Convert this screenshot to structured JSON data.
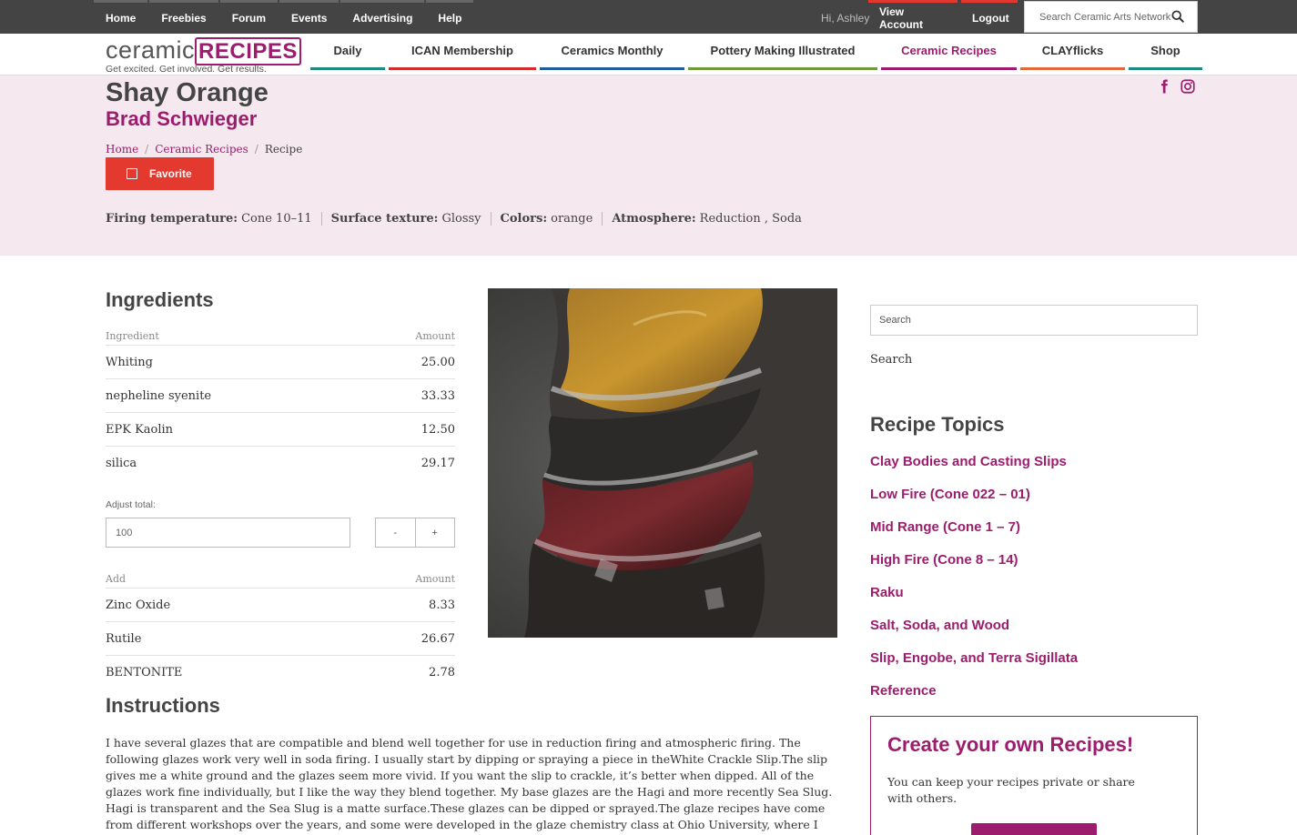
{
  "topbar": {
    "links": [
      "Home",
      "Freebies",
      "Forum",
      "Events",
      "Advertising",
      "Help"
    ],
    "greeting": "Hi, Ashley",
    "view_account": "View Account",
    "logout": "Logout",
    "search_placeholder": "Search Ceramic Arts Network"
  },
  "logo": {
    "ceramic": "ceramic",
    "recipes": "RECIPES",
    "tagline": "Get excited. Get involved. Get results."
  },
  "nav": {
    "items": [
      {
        "label": "Daily",
        "color": "#1f8a7e"
      },
      {
        "label": "ICAN Membership",
        "color": "#d22d2d"
      },
      {
        "label": "Ceramics Monthly",
        "color": "#1f5fa0"
      },
      {
        "label": "Pottery Making Illustrated",
        "color": "#6e9a3a"
      },
      {
        "label": "Ceramic Recipes",
        "color": "#9c1c6e"
      },
      {
        "label": "CLAYflicks",
        "color": "#e06a3a"
      },
      {
        "label": "Shop",
        "color": "#1f8a7e"
      }
    ],
    "active": "Ceramic Recipes"
  },
  "recipe": {
    "title": "Shay Orange",
    "author": "Brad Schwieger",
    "breadcrumb": [
      "Home",
      "Ceramic Recipes",
      "Recipe"
    ],
    "favorite_label": "Favorite",
    "properties": [
      {
        "label": "Firing temperature:",
        "value": "Cone 10–11"
      },
      {
        "label": "Surface texture:",
        "value": "Glossy"
      },
      {
        "label": "Colors:",
        "value": "orange"
      },
      {
        "label": "Atmosphere:",
        "value": "Reduction ,  Soda"
      }
    ]
  },
  "ingredients": {
    "title": "Ingredients",
    "headers": [
      "Ingredient",
      "Amount"
    ],
    "rows": [
      [
        "Whiting",
        "25.00"
      ],
      [
        "nepheline syenite",
        "33.33"
      ],
      [
        "EPK Kaolin",
        "12.50"
      ],
      [
        "silica",
        "29.17"
      ]
    ],
    "adjust_label": "Adjust total:",
    "adjust_value": "100",
    "minus": "-",
    "plus": "+",
    "add_headers": [
      "Add",
      "Amount"
    ],
    "add_rows": [
      [
        "Zinc Oxide",
        "8.33"
      ],
      [
        "Rutile",
        "26.67"
      ],
      [
        "BENTONITE",
        "2.78"
      ]
    ]
  },
  "instructions": {
    "title": "Instructions",
    "text": "I have several glazes that are compatible and blend well together for use in reduction firing and atmospheric firing. The following glazes work very well in soda firing. I usually start by dipping or spraying a piece in theWhite Crackle Slip.The slip gives me a white ground and the glazes seem more vivid. If you want the slip to crackle, it’s better when dipped. All of the glazes work fine individually, but I like the way they blend together. My base glazes are the Hagi and more recently Sea Slug. Hagi is transparent and the Sea Slug is a matte surface.These glazes can be dipped or sprayed.The glaze recipes have come from different workshops over the years, and some were developed in the glaze chemistry class at Ohio University, where I teach."
  },
  "sidebar": {
    "search_placeholder": "Search",
    "search_button": "Search",
    "topics_title": "Recipe Topics",
    "topics": [
      "Clay Bodies and Casting Slips",
      "Low Fire (Cone 022 – 01)",
      "Mid Range (Cone 1 – 7)",
      "High Fire (Cone 8 – 14)",
      "Raku",
      "Salt, Soda, and Wood",
      "Slip, Engobe, and Terra Sigillata",
      "Reference"
    ],
    "cta_title": "Create your own Recipes!",
    "cta_text": "You can keep your recipes private or share with others."
  },
  "colors": {
    "accent": "#9c1c6e",
    "favorite": "#e3392e",
    "hero_bg": "#f6e8ef",
    "topbar": "#444444"
  },
  "icons": [
    "search-icon",
    "facebook-icon",
    "instagram-icon",
    "checkbox-icon"
  ]
}
